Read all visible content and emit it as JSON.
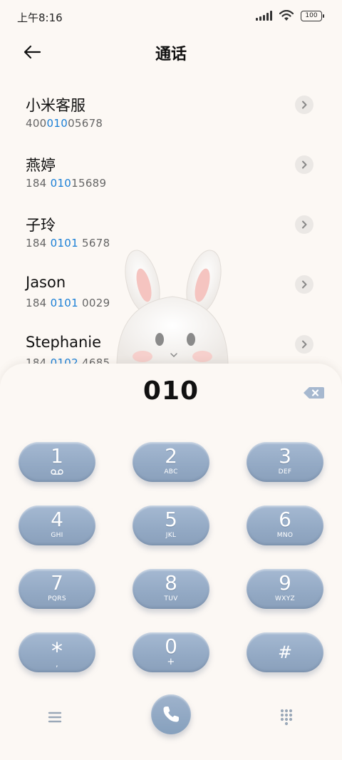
{
  "status_bar": {
    "time": "上午8:16",
    "battery": "100"
  },
  "header": {
    "title": "通话"
  },
  "contacts": [
    {
      "name": "小米客服",
      "num_pre": "400",
      "num_hl": "010",
      "num_post": "05678"
    },
    {
      "name": "燕婷",
      "num_pre": "184 ",
      "num_hl": "010",
      "num_post": "15689"
    },
    {
      "name": "子玲",
      "num_pre": "184 ",
      "num_hl": "0101",
      "num_post": " 5678"
    },
    {
      "name": "Jason",
      "num_pre": "184 ",
      "num_hl": "0101",
      "num_post": " 0029"
    },
    {
      "name": "Stephanie",
      "num_pre": "184 ",
      "num_hl": "0102",
      "num_post": " 4685"
    }
  ],
  "dialer": {
    "input_value": "010",
    "keys": [
      {
        "digit": "1",
        "letters": ""
      },
      {
        "digit": "2",
        "letters": "ABC"
      },
      {
        "digit": "3",
        "letters": "DEF"
      },
      {
        "digit": "4",
        "letters": "GHI"
      },
      {
        "digit": "5",
        "letters": "JKL"
      },
      {
        "digit": "6",
        "letters": "MNO"
      },
      {
        "digit": "7",
        "letters": "PQRS"
      },
      {
        "digit": "8",
        "letters": "TUV"
      },
      {
        "digit": "9",
        "letters": "WXYZ"
      },
      {
        "digit": "*",
        "letters": ","
      },
      {
        "digit": "0",
        "letters": "+"
      },
      {
        "digit": "#",
        "letters": ""
      }
    ]
  },
  "icons": {
    "back": "back-arrow-icon",
    "chevron": "chevron-right-icon",
    "voicemail": "voicemail-icon",
    "backspace": "backspace-icon",
    "menu": "menu-icon",
    "call": "phone-icon",
    "keypad": "keypad-icon"
  },
  "colors": {
    "background": "#fcf8f4",
    "key": "#93a9c4",
    "highlight": "#1a7fd6"
  }
}
